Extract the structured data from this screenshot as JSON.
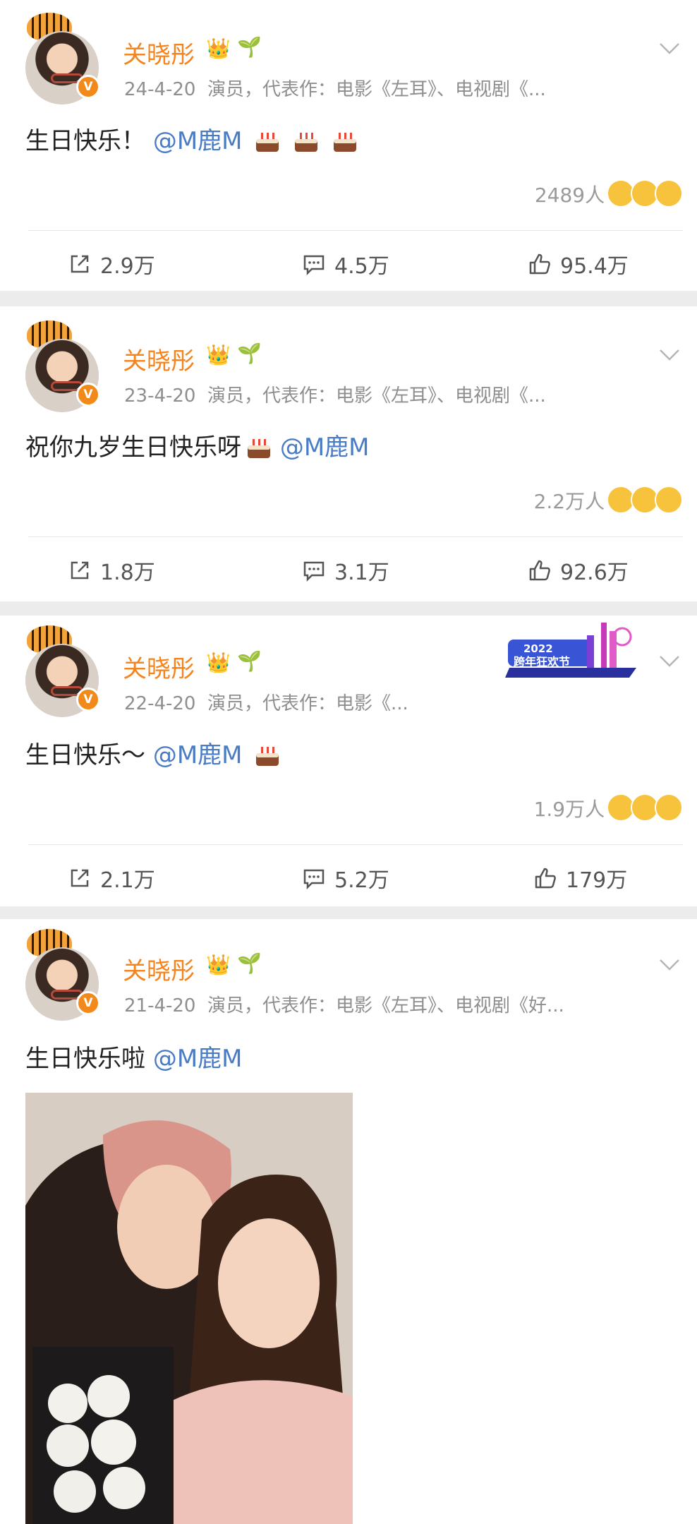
{
  "posts": [
    {
      "author": "关晓彤",
      "date": "24-4-20",
      "bio": "演员，代表作：电影《左耳》、电视剧《...",
      "text": "生日快乐！",
      "mention": "@M鹿M",
      "cakes": 3,
      "reactions": "2489人",
      "shares": "2.9万",
      "comments": "4.5万",
      "likes": "95.4万"
    },
    {
      "author": "关晓彤",
      "date": "23-4-20",
      "bio": "演员，代表作：电影《左耳》、电视剧《...",
      "text": "祝你九岁生日快乐呀",
      "mention": "@M鹿M",
      "cakes": 1,
      "reactions": "2.2万人",
      "shares": "1.8万",
      "comments": "3.1万",
      "likes": "92.6万"
    },
    {
      "author": "关晓彤",
      "date": "22-4-20",
      "bio": "演员，代表作：电影《...",
      "text": "生日快乐～",
      "mention": "@M鹿M",
      "cakes": 1,
      "reactions": "1.9万人",
      "shares": "2.1万",
      "comments": "5.2万",
      "likes": "179万",
      "badge_year": "2022",
      "badge_text": "跨年狂欢节"
    },
    {
      "author": "关晓彤",
      "date": "21-4-20",
      "bio": "演员，代表作：电影《左耳》、电视剧《好...",
      "text": "生日快乐啦",
      "mention": "@M鹿M"
    }
  ],
  "colors": {
    "author": "#f5841f",
    "mention": "#4a7cc5",
    "meta": "#8e8e8e",
    "separator": "#ececec"
  },
  "icons": [
    "share-icon",
    "comment-icon",
    "like-icon",
    "chevron-down-icon",
    "crown-icon",
    "sprout-icon",
    "cake-icon",
    "verified-badge-icon",
    "laugh-emoji-icon"
  ]
}
